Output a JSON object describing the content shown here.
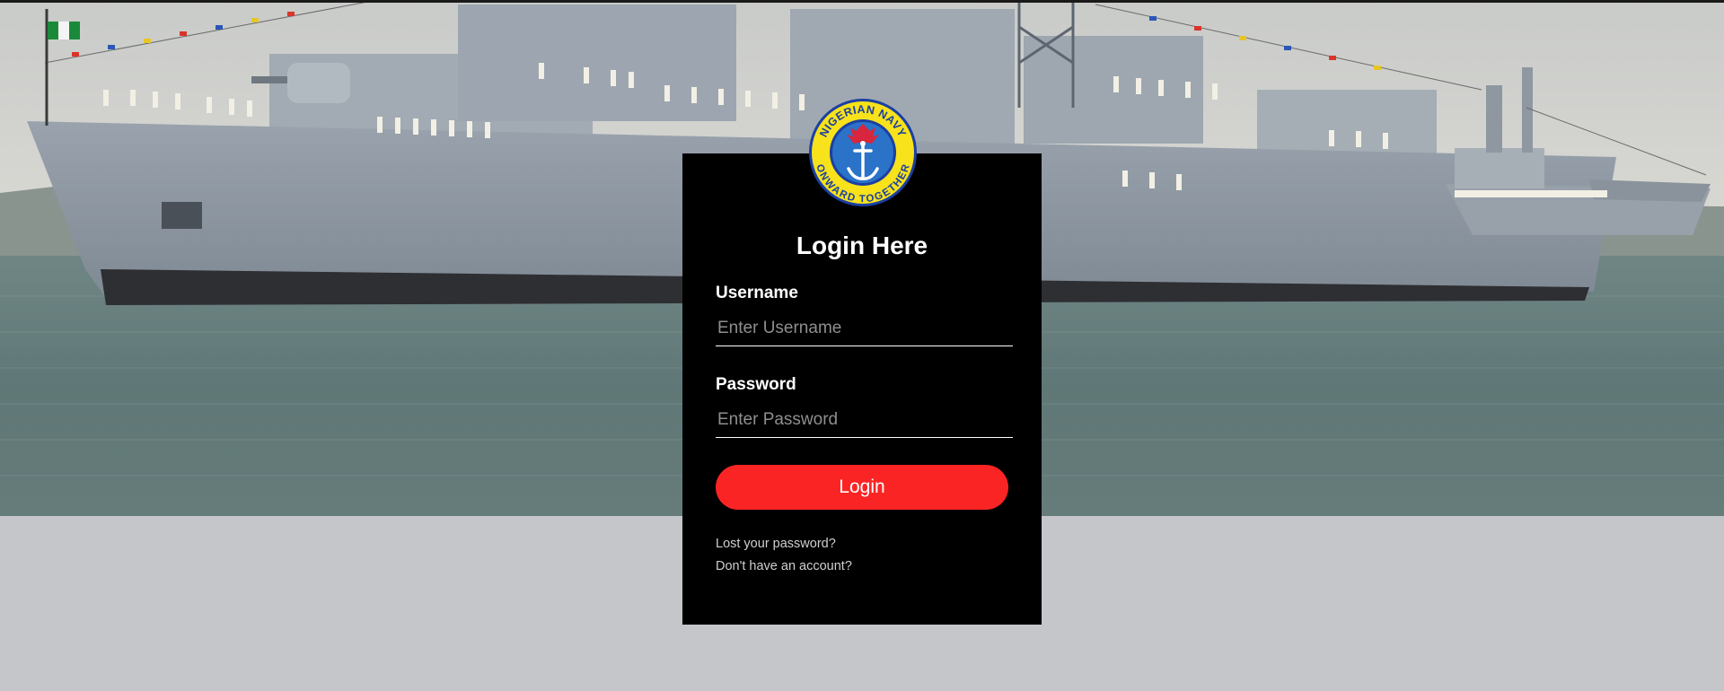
{
  "emblem": {
    "name": "nigerian-navy-emblem",
    "top_text": "NIGERIAN NAVY",
    "bottom_text": "ONWARD TOGETHER",
    "colors": {
      "ring": "#f7e21b",
      "ring_border": "#1b3fa3",
      "inner": "#2a5fc0",
      "eagle": "#d7263d",
      "anchor": "#ffffff"
    }
  },
  "login": {
    "title": "Login Here",
    "username_label": "Username",
    "username_placeholder": "Enter Username",
    "password_label": "Password",
    "password_placeholder": "Enter Password",
    "submit_label": "Login",
    "lost_password_link": "Lost your password?",
    "signup_link": "Don't have an account?"
  },
  "colors": {
    "box_background": "#000000",
    "button": "#fb2424",
    "page_background": "#c4c6c9"
  }
}
